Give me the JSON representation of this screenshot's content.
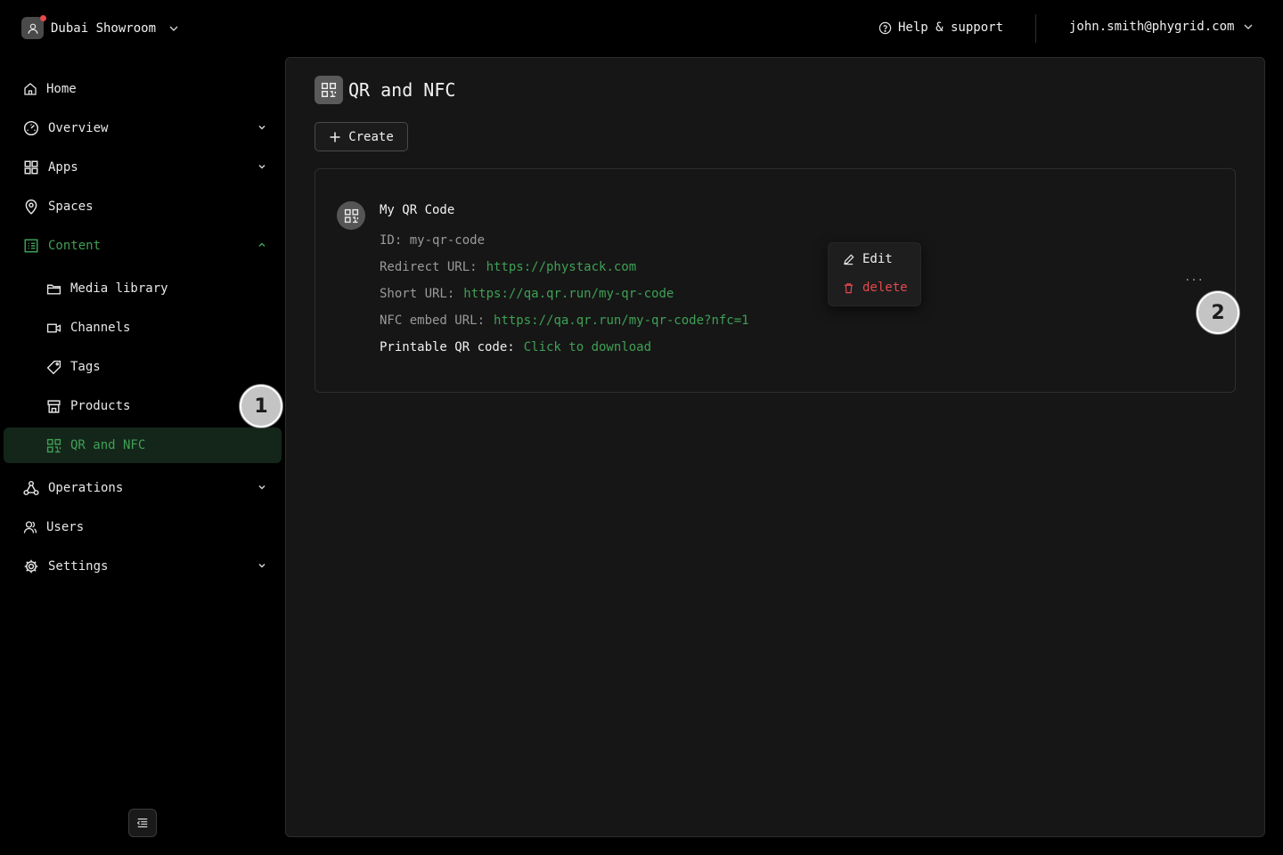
{
  "topbar": {
    "workspace_name": "Dubai Showroom",
    "help_label": "Help & support",
    "account_email": "john.smith@phygrid.com"
  },
  "sidebar": {
    "items": [
      {
        "label": "Home",
        "icon": "home-icon"
      },
      {
        "label": "Overview",
        "icon": "gauge-icon",
        "expandable": true
      },
      {
        "label": "Apps",
        "icon": "apps-grid-icon",
        "expandable": true
      },
      {
        "label": "Spaces",
        "icon": "map-pin-icon"
      },
      {
        "label": "Content",
        "icon": "content-list-icon",
        "expandable": true,
        "expanded": true
      },
      {
        "label": "Operations",
        "icon": "network-icon",
        "expandable": true
      },
      {
        "label": "Users",
        "icon": "users-icon"
      },
      {
        "label": "Settings",
        "icon": "gear-icon",
        "expandable": true
      }
    ],
    "content_children": [
      {
        "label": "Media library",
        "icon": "folder-icon"
      },
      {
        "label": "Channels",
        "icon": "video-icon"
      },
      {
        "label": "Tags",
        "icon": "tag-icon"
      },
      {
        "label": "Products",
        "icon": "store-icon"
      },
      {
        "label": "QR and NFC",
        "icon": "qr-icon",
        "active": true
      }
    ]
  },
  "main": {
    "title": "QR and NFC",
    "create_label": "Create",
    "card": {
      "title": "My QR Code",
      "id_line": "ID: my-qr-code",
      "redirect_label": "Redirect URL:",
      "redirect_url": "https://phystack.com",
      "short_label": "Short URL:",
      "short_url": "https://qa.qr.run/my-qr-code",
      "nfc_label": "NFC embed URL:",
      "nfc_url": "https://qa.qr.run/my-qr-code?nfc=1",
      "printable_label": "Printable QR code:",
      "printable_link": "Click to download",
      "more_label": "..."
    },
    "menu": {
      "edit_label": "Edit",
      "delete_label": "delete"
    }
  },
  "badges": {
    "one": "1",
    "two": "2"
  },
  "colors": {
    "accent_green": "#3fa055",
    "danger_red": "#e5484d",
    "background": "#000000",
    "panel": "#161616"
  }
}
